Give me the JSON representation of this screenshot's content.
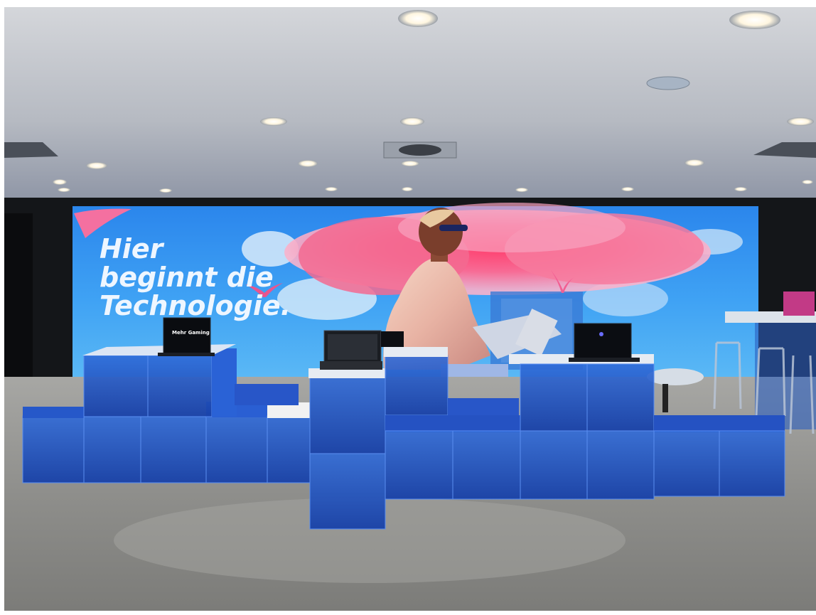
{
  "screen": {
    "headline_lines": [
      "Hier",
      "beginnt die",
      "Technologie."
    ]
  },
  "laptops": {
    "left_screen_text": "Mehr Gaming"
  },
  "colors": {
    "ceiling": "#c9ccd1",
    "screen_sky": "#2f8ff0",
    "cloud_pink": "#f0487a",
    "cube_blue": "#1f55c9",
    "carpet": "#8c8c88"
  }
}
